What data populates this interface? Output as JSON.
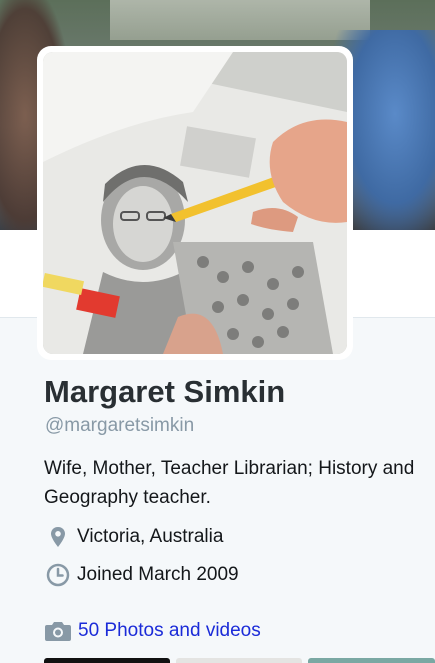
{
  "profile": {
    "name": "Margaret Simkin",
    "handle": "@margaretsimkin",
    "bio": "Wife, Mother, Teacher Librarian; History and Geography teacher.",
    "location": "Victoria, Australia",
    "joined": "Joined March 2009",
    "media_link": "50 Photos and videos"
  },
  "icons": {
    "location": "map-pin-icon",
    "joined": "clock-icon",
    "media": "camera-icon"
  },
  "colors": {
    "link": "#1b2bd8",
    "muted": "#8899a6",
    "icon": "#8899a6"
  }
}
